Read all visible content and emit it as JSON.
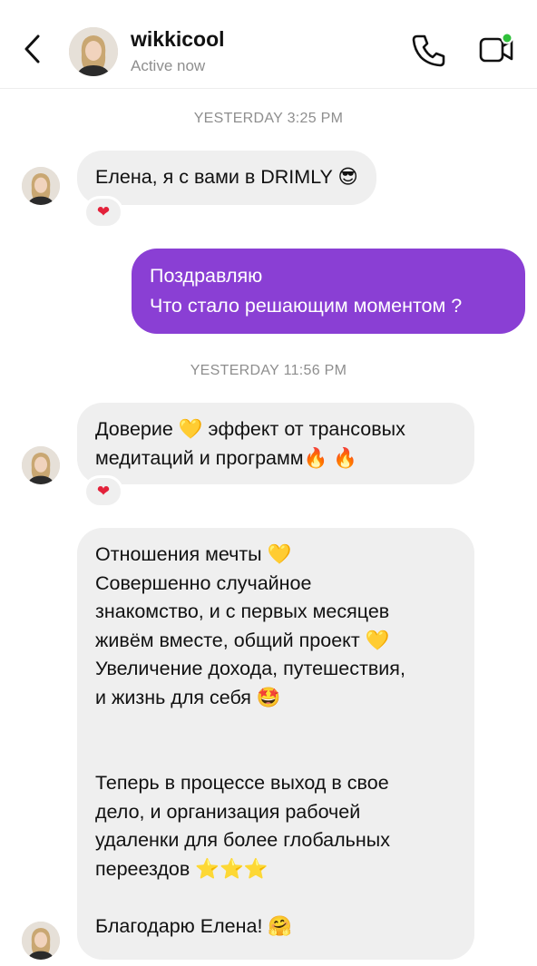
{
  "header": {
    "username": "wikkicool",
    "status": "Active now"
  },
  "timestamps": {
    "first": "YESTERDAY 3:25 PM",
    "second": "YESTERDAY 11:56 PM"
  },
  "messages": {
    "m1": {
      "lines": [
        "Елена, я с вами в DRIMLY 😎"
      ],
      "reaction": "❤"
    },
    "m2": {
      "lines": [
        "Поздравляю",
        "Что стало решающим моментом ?"
      ]
    },
    "m3": {
      "lines": [
        "Доверие 💛  эффект от трансовых",
        "медитаций и программ🔥 🔥"
      ],
      "reaction": "❤"
    },
    "m4": {
      "lines": [
        "Отношения мечты 💛",
        "Совершенно случайное",
        "знакомство, и с первых месяцев",
        "живём вместе, общий проект 💛",
        "Увеличение дохода, путешествия,",
        "и жизнь для себя 🤩",
        "",
        "",
        "Теперь в процессе выход в свое",
        "дело, и организация рабочей",
        "удаленки для более глобальных",
        "переездов ⭐⭐⭐",
        "",
        "Благодарю Елена! 🤗"
      ]
    }
  },
  "colors": {
    "outgoing_bubble": "#8a3fd4",
    "incoming_bubble": "#efefef",
    "online_dot": "#2fc03a"
  }
}
